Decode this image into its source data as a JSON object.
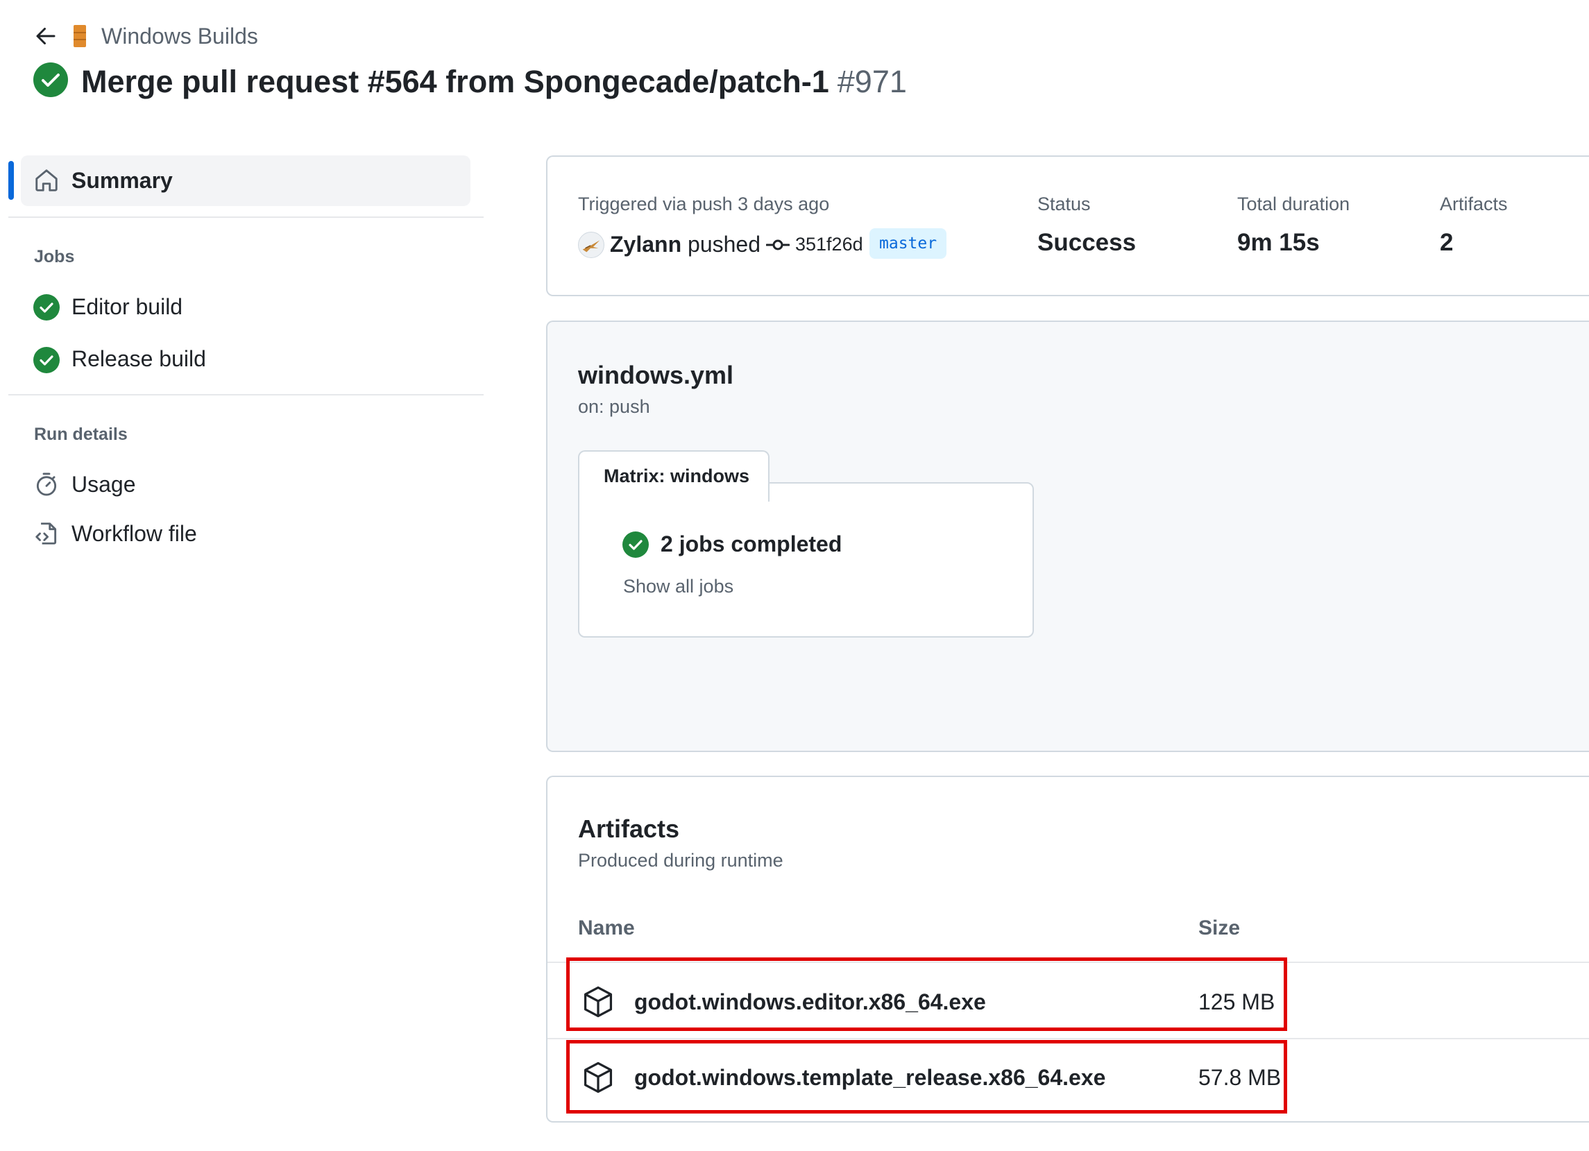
{
  "header": {
    "workflow_name": "Windows Builds",
    "run_title": "Merge pull request #564 from Spongecade/patch-1",
    "run_number": "#971"
  },
  "sidebar": {
    "summary_label": "Summary",
    "jobs_heading": "Jobs",
    "jobs": [
      {
        "label": "Editor build",
        "status": "success"
      },
      {
        "label": "Release build",
        "status": "success"
      }
    ],
    "run_details_heading": "Run details",
    "details": [
      {
        "label": "Usage",
        "icon": "stopwatch-icon"
      },
      {
        "label": "Workflow file",
        "icon": "file-code-icon"
      }
    ]
  },
  "run_info": {
    "trigger": "Triggered via push 3 days ago",
    "actor": "Zylann",
    "action": "pushed",
    "commit_sha": "351f26d",
    "branch": "master",
    "status_label": "Status",
    "status_value": "Success",
    "duration_label": "Total duration",
    "duration_value": "9m 15s",
    "artifacts_label": "Artifacts",
    "artifacts_value": "2"
  },
  "workflow": {
    "file": "windows.yml",
    "trigger": "on: push",
    "matrix_label": "Matrix: windows",
    "jobs_completed": "2 jobs completed",
    "show_all": "Show all jobs"
  },
  "artifacts": {
    "title": "Artifacts",
    "subtitle": "Produced during runtime",
    "col_name": "Name",
    "col_size": "Size",
    "items": [
      {
        "name": "godot.windows.editor.x86_64.exe",
        "size": "125 MB"
      },
      {
        "name": "godot.windows.template_release.x86_64.exe",
        "size": "57.8 MB"
      }
    ]
  },
  "colors": {
    "success": "#1f883d",
    "accent": "#0969da",
    "highlight": "#e00000"
  }
}
